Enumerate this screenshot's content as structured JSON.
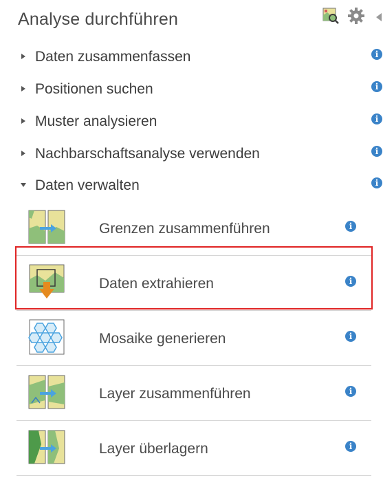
{
  "header": {
    "title": "Analyse durchführen",
    "icons": [
      "map-search-icon",
      "gear-icon",
      "collapse-icon"
    ]
  },
  "categories": [
    {
      "label": "Daten zusammenfassen",
      "expanded": false
    },
    {
      "label": "Positionen suchen",
      "expanded": false
    },
    {
      "label": "Muster analysieren",
      "expanded": false
    },
    {
      "label": "Nachbarschaftsanalyse verwenden",
      "expanded": false
    },
    {
      "label": "Daten verwalten",
      "expanded": true
    }
  ],
  "tools": [
    {
      "label": "Grenzen zusammenführen",
      "icon": "dissolve-boundaries-icon"
    },
    {
      "label": "Daten extrahieren",
      "icon": "extract-data-icon",
      "highlighted": true
    },
    {
      "label": "Mosaike generieren",
      "icon": "generate-tessellations-icon"
    },
    {
      "label": "Layer zusammenführen",
      "icon": "merge-layers-icon"
    },
    {
      "label": "Layer überlagern",
      "icon": "overlay-layers-icon"
    }
  ],
  "info_glyph": "i",
  "colors": {
    "info": "#3a83c8",
    "highlight": "#e02424",
    "map_green": "#8fbf7a",
    "map_yellow": "#e8e29a",
    "map_blue": "#4aa3df",
    "extract_orange": "#e58a1f"
  }
}
